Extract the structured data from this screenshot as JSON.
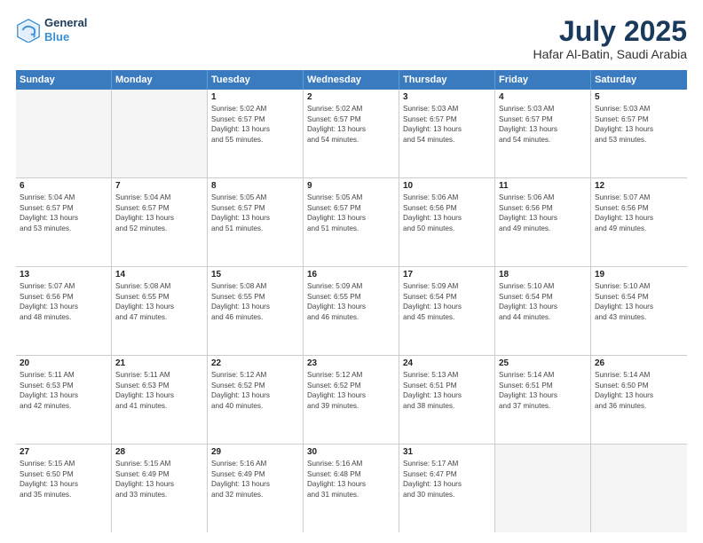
{
  "logo": {
    "line1": "General",
    "line2": "Blue"
  },
  "title": "July 2025",
  "subtitle": "Hafar Al-Batin, Saudi Arabia",
  "days_of_week": [
    "Sunday",
    "Monday",
    "Tuesday",
    "Wednesday",
    "Thursday",
    "Friday",
    "Saturday"
  ],
  "weeks": [
    [
      {
        "day": "",
        "empty": true,
        "lines": []
      },
      {
        "day": "",
        "empty": true,
        "lines": []
      },
      {
        "day": "1",
        "empty": false,
        "lines": [
          "Sunrise: 5:02 AM",
          "Sunset: 6:57 PM",
          "Daylight: 13 hours",
          "and 55 minutes."
        ]
      },
      {
        "day": "2",
        "empty": false,
        "lines": [
          "Sunrise: 5:02 AM",
          "Sunset: 6:57 PM",
          "Daylight: 13 hours",
          "and 54 minutes."
        ]
      },
      {
        "day": "3",
        "empty": false,
        "lines": [
          "Sunrise: 5:03 AM",
          "Sunset: 6:57 PM",
          "Daylight: 13 hours",
          "and 54 minutes."
        ]
      },
      {
        "day": "4",
        "empty": false,
        "lines": [
          "Sunrise: 5:03 AM",
          "Sunset: 6:57 PM",
          "Daylight: 13 hours",
          "and 54 minutes."
        ]
      },
      {
        "day": "5",
        "empty": false,
        "lines": [
          "Sunrise: 5:03 AM",
          "Sunset: 6:57 PM",
          "Daylight: 13 hours",
          "and 53 minutes."
        ]
      }
    ],
    [
      {
        "day": "6",
        "empty": false,
        "lines": [
          "Sunrise: 5:04 AM",
          "Sunset: 6:57 PM",
          "Daylight: 13 hours",
          "and 53 minutes."
        ]
      },
      {
        "day": "7",
        "empty": false,
        "lines": [
          "Sunrise: 5:04 AM",
          "Sunset: 6:57 PM",
          "Daylight: 13 hours",
          "and 52 minutes."
        ]
      },
      {
        "day": "8",
        "empty": false,
        "lines": [
          "Sunrise: 5:05 AM",
          "Sunset: 6:57 PM",
          "Daylight: 13 hours",
          "and 51 minutes."
        ]
      },
      {
        "day": "9",
        "empty": false,
        "lines": [
          "Sunrise: 5:05 AM",
          "Sunset: 6:57 PM",
          "Daylight: 13 hours",
          "and 51 minutes."
        ]
      },
      {
        "day": "10",
        "empty": false,
        "lines": [
          "Sunrise: 5:06 AM",
          "Sunset: 6:56 PM",
          "Daylight: 13 hours",
          "and 50 minutes."
        ]
      },
      {
        "day": "11",
        "empty": false,
        "lines": [
          "Sunrise: 5:06 AM",
          "Sunset: 6:56 PM",
          "Daylight: 13 hours",
          "and 49 minutes."
        ]
      },
      {
        "day": "12",
        "empty": false,
        "lines": [
          "Sunrise: 5:07 AM",
          "Sunset: 6:56 PM",
          "Daylight: 13 hours",
          "and 49 minutes."
        ]
      }
    ],
    [
      {
        "day": "13",
        "empty": false,
        "lines": [
          "Sunrise: 5:07 AM",
          "Sunset: 6:56 PM",
          "Daylight: 13 hours",
          "and 48 minutes."
        ]
      },
      {
        "day": "14",
        "empty": false,
        "lines": [
          "Sunrise: 5:08 AM",
          "Sunset: 6:55 PM",
          "Daylight: 13 hours",
          "and 47 minutes."
        ]
      },
      {
        "day": "15",
        "empty": false,
        "lines": [
          "Sunrise: 5:08 AM",
          "Sunset: 6:55 PM",
          "Daylight: 13 hours",
          "and 46 minutes."
        ]
      },
      {
        "day": "16",
        "empty": false,
        "lines": [
          "Sunrise: 5:09 AM",
          "Sunset: 6:55 PM",
          "Daylight: 13 hours",
          "and 46 minutes."
        ]
      },
      {
        "day": "17",
        "empty": false,
        "lines": [
          "Sunrise: 5:09 AM",
          "Sunset: 6:54 PM",
          "Daylight: 13 hours",
          "and 45 minutes."
        ]
      },
      {
        "day": "18",
        "empty": false,
        "lines": [
          "Sunrise: 5:10 AM",
          "Sunset: 6:54 PM",
          "Daylight: 13 hours",
          "and 44 minutes."
        ]
      },
      {
        "day": "19",
        "empty": false,
        "lines": [
          "Sunrise: 5:10 AM",
          "Sunset: 6:54 PM",
          "Daylight: 13 hours",
          "and 43 minutes."
        ]
      }
    ],
    [
      {
        "day": "20",
        "empty": false,
        "lines": [
          "Sunrise: 5:11 AM",
          "Sunset: 6:53 PM",
          "Daylight: 13 hours",
          "and 42 minutes."
        ]
      },
      {
        "day": "21",
        "empty": false,
        "lines": [
          "Sunrise: 5:11 AM",
          "Sunset: 6:53 PM",
          "Daylight: 13 hours",
          "and 41 minutes."
        ]
      },
      {
        "day": "22",
        "empty": false,
        "lines": [
          "Sunrise: 5:12 AM",
          "Sunset: 6:52 PM",
          "Daylight: 13 hours",
          "and 40 minutes."
        ]
      },
      {
        "day": "23",
        "empty": false,
        "lines": [
          "Sunrise: 5:12 AM",
          "Sunset: 6:52 PM",
          "Daylight: 13 hours",
          "and 39 minutes."
        ]
      },
      {
        "day": "24",
        "empty": false,
        "lines": [
          "Sunrise: 5:13 AM",
          "Sunset: 6:51 PM",
          "Daylight: 13 hours",
          "and 38 minutes."
        ]
      },
      {
        "day": "25",
        "empty": false,
        "lines": [
          "Sunrise: 5:14 AM",
          "Sunset: 6:51 PM",
          "Daylight: 13 hours",
          "and 37 minutes."
        ]
      },
      {
        "day": "26",
        "empty": false,
        "lines": [
          "Sunrise: 5:14 AM",
          "Sunset: 6:50 PM",
          "Daylight: 13 hours",
          "and 36 minutes."
        ]
      }
    ],
    [
      {
        "day": "27",
        "empty": false,
        "lines": [
          "Sunrise: 5:15 AM",
          "Sunset: 6:50 PM",
          "Daylight: 13 hours",
          "and 35 minutes."
        ]
      },
      {
        "day": "28",
        "empty": false,
        "lines": [
          "Sunrise: 5:15 AM",
          "Sunset: 6:49 PM",
          "Daylight: 13 hours",
          "and 33 minutes."
        ]
      },
      {
        "day": "29",
        "empty": false,
        "lines": [
          "Sunrise: 5:16 AM",
          "Sunset: 6:49 PM",
          "Daylight: 13 hours",
          "and 32 minutes."
        ]
      },
      {
        "day": "30",
        "empty": false,
        "lines": [
          "Sunrise: 5:16 AM",
          "Sunset: 6:48 PM",
          "Daylight: 13 hours",
          "and 31 minutes."
        ]
      },
      {
        "day": "31",
        "empty": false,
        "lines": [
          "Sunrise: 5:17 AM",
          "Sunset: 6:47 PM",
          "Daylight: 13 hours",
          "and 30 minutes."
        ]
      },
      {
        "day": "",
        "empty": true,
        "lines": []
      },
      {
        "day": "",
        "empty": true,
        "lines": []
      }
    ]
  ]
}
